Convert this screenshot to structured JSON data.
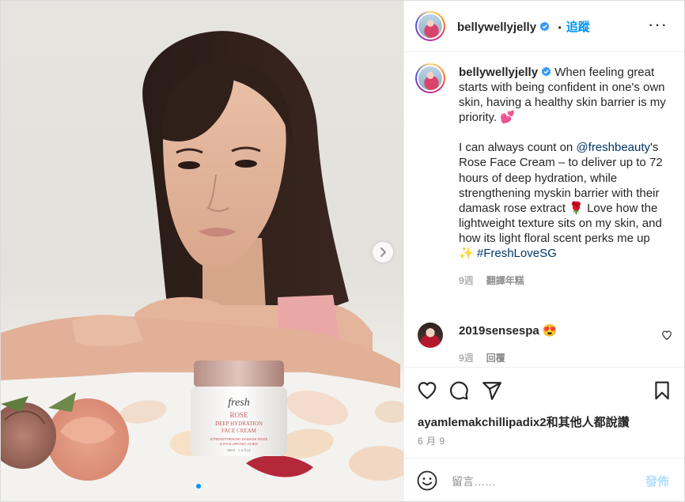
{
  "post": {
    "author": "bellywellyjelly",
    "follow_label": "追蹤",
    "separator": "•",
    "more_label": "···",
    "brand_text": "fresh",
    "jar_line1": "ROSE",
    "jar_line2": "DEEP HYDRATION",
    "jar_line3": "FACE CREAM",
    "jar_line4": "STRENGTHENING DAMASK ROSE",
    "jar_line5": "& HYALURONIC ACIDS",
    "jar_size": "50ml · 1.6 fl.oz"
  },
  "caption": {
    "author": "bellywellyjelly",
    "text1": "When feeling great starts with being confident in one's own skin, having a healthy skin barrier is my priority. 💕",
    "text2_pre": "I can always count on ",
    "mention": "@freshbeauty",
    "text2_post": "'s Rose Face Cream – to deliver up to 72 hours of deep hydration, while strengthening myskin barrier with their damask rose extract 🌹 Love how the lightweight texture sits on my skin, and how its light floral scent perks me up ✨ ",
    "hashtag": "#FreshLoveSG",
    "time": "9週",
    "see_translation": "翻譯年糕"
  },
  "comment": {
    "author": "2019sensespa",
    "text": "😍",
    "time": "9週",
    "reply_label": "回覆"
  },
  "engagement": {
    "liked_by": "ayamlemakchillipadix2和其他人都說讚",
    "date": "6 月 9"
  },
  "composer": {
    "placeholder": "留言……",
    "post_label": "發佈"
  },
  "colors": {
    "accent": "#0095f6",
    "link": "#00376b",
    "muted": "#8e8e8e",
    "post_disabled": "#b2dffc"
  },
  "icons": [
    "verified-badge-icon",
    "more-options-icon",
    "heart-icon",
    "comment-icon",
    "share-icon",
    "bookmark-icon",
    "emoji-icon",
    "chevron-right-icon"
  ]
}
